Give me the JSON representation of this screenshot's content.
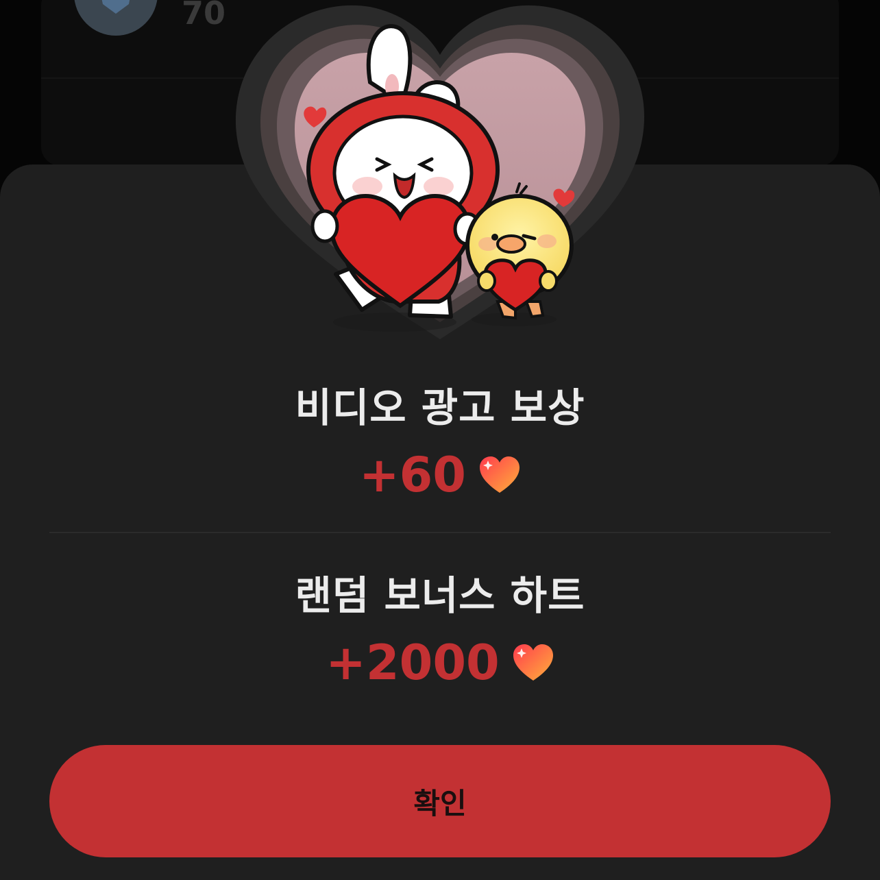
{
  "background": {
    "count": "70"
  },
  "rewards": [
    {
      "title": "비디오 광고 보상",
      "amount": "+60",
      "icon": "heart-icon"
    },
    {
      "title": "랜덤 보너스 하트",
      "amount": "+2000",
      "icon": "heart-icon"
    }
  ],
  "confirm_label": "확인",
  "colors": {
    "accent": "#c33133",
    "sheet": "#1f1f1f",
    "text": "#ececec"
  }
}
